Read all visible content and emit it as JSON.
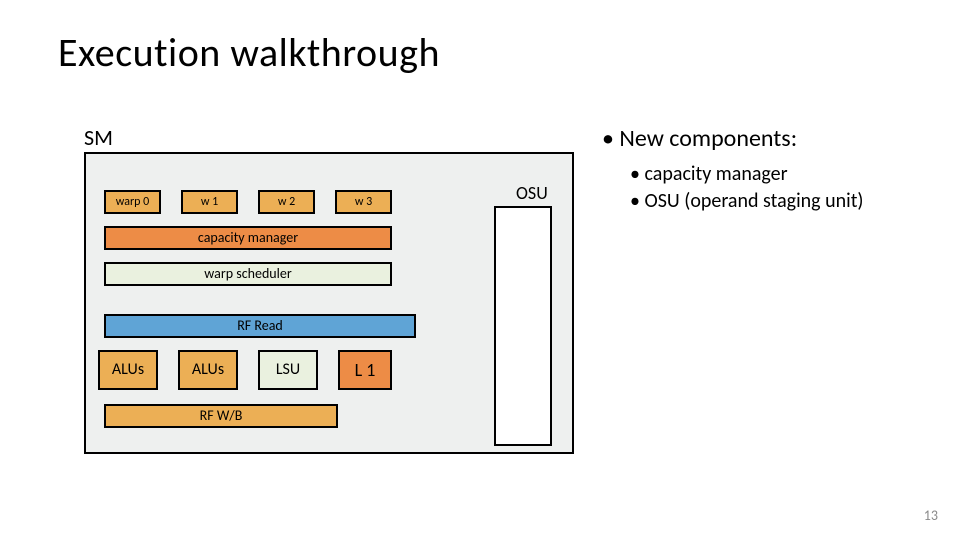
{
  "title": "Execution walkthrough",
  "sm_label": "SM",
  "warps": [
    "warp 0",
    "w 1",
    "w 2",
    "w 3"
  ],
  "capacity_manager": "capacity manager",
  "warp_scheduler": "warp scheduler",
  "rf_read": "RF Read",
  "units": {
    "alu1": "ALUs",
    "alu2": "ALUs",
    "lsu": "LSU",
    "l1": "L 1"
  },
  "rf_wb": "RF W/B",
  "osu_label": "OSU",
  "bullets": {
    "main": "New components:",
    "sub1": "capacity manager",
    "sub2": "OSU (operand staging unit)"
  },
  "page_number": "13"
}
